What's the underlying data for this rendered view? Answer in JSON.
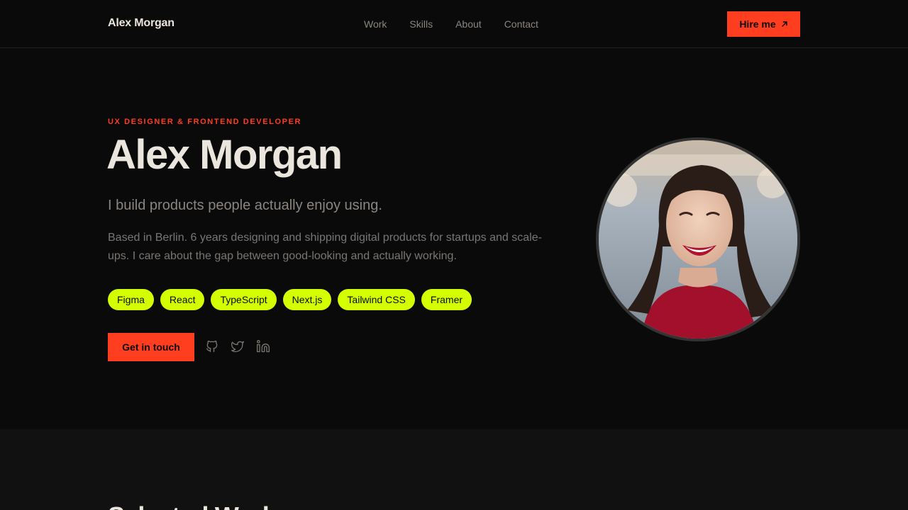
{
  "header": {
    "brand": "Alex Morgan",
    "nav": [
      {
        "label": "Work"
      },
      {
        "label": "Skills"
      },
      {
        "label": "About"
      },
      {
        "label": "Contact"
      }
    ],
    "hire_label": "Hire me",
    "hire_icon": "arrow-up-right-icon"
  },
  "hero": {
    "eyebrow": "UX DESIGNER & FRONTEND DEVELOPER",
    "name": "Alex Morgan",
    "tagline": "I build products people actually enjoy using.",
    "bio": "Based in Berlin. 6 years designing and shipping digital products for startups and scale-ups. I care about the gap between good-looking and actually working.",
    "skills": [
      "Figma",
      "React",
      "TypeScript",
      "Next.js",
      "Tailwind CSS",
      "Framer"
    ],
    "cta_label": "Get in touch",
    "socials": [
      "github-icon",
      "twitter-icon",
      "linkedin-icon"
    ]
  },
  "section2": {
    "title": "Selected Work"
  },
  "colors": {
    "background": "#0a0a0a",
    "accent": "#ff3d1f",
    "tag": "#d4ff00",
    "text": "#ebe6dd",
    "muted": "#8a8580"
  }
}
